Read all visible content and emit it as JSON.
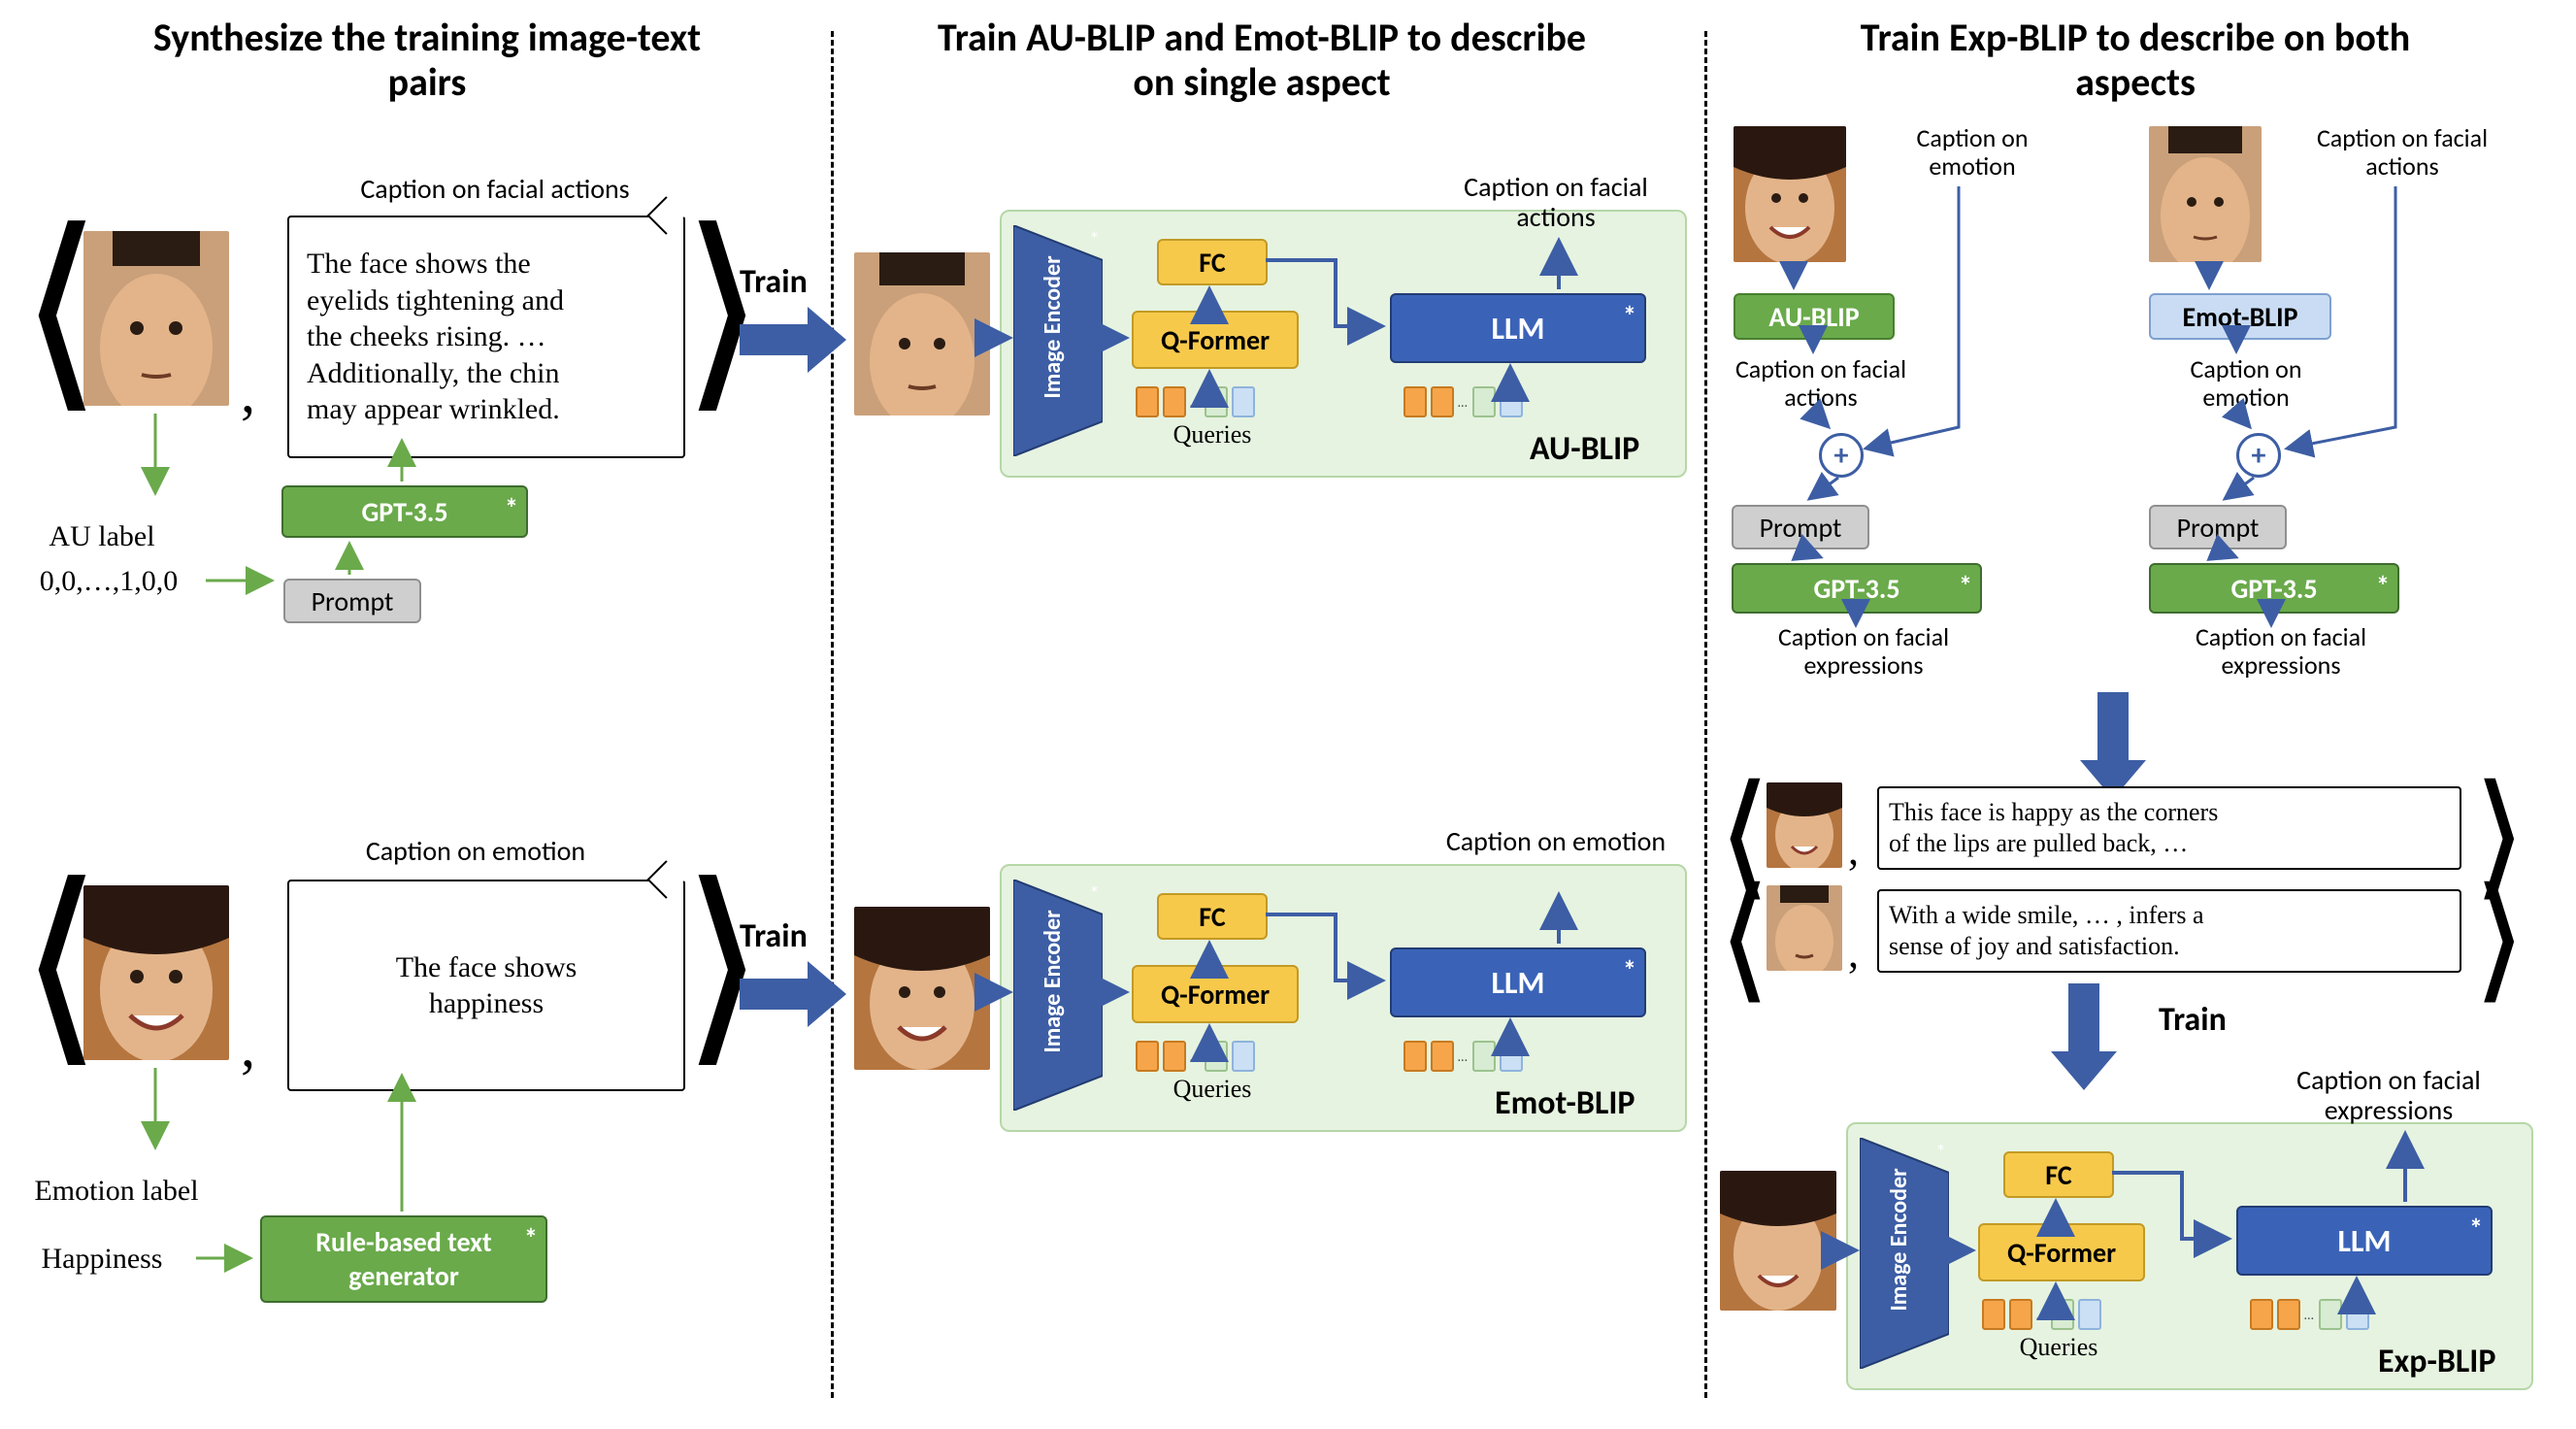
{
  "headings": {
    "col1": "Synthesize the training\nimage-text pairs",
    "col2": "Train AU-BLIP and Emot-BLIP to\ndescribe on single aspect",
    "col3": "Train Exp-BLIP to\ndescribe on both aspects"
  },
  "col1": {
    "au": {
      "caption_title": "Caption on facial actions",
      "caption_text": "The face shows the\neyelids tightening and\nthe cheeks rising. …\nAdditionally, the chin\nmay appear wrinkled.",
      "au_label_title": "AU label",
      "au_label_vector": "0,0,…,1,0,0",
      "gpt_block": "GPT-3.5",
      "prompt_block": "Prompt"
    },
    "emot": {
      "caption_title": "Caption on emotion",
      "caption_text": "The face shows\nhappiness",
      "emotion_label_title": "Emotion label",
      "emotion_label_value": "Happiness",
      "rule_block": "Rule-based text\ngenerator"
    },
    "train_label": "Train"
  },
  "col2": {
    "au": {
      "caption_out": "Caption on\nfacial actions",
      "blip_name": "AU-BLIP"
    },
    "emot": {
      "caption_out": "Caption on\nemotion",
      "blip_name": "Emot-BLIP"
    },
    "common": {
      "image_encoder": "Image\nEncoder",
      "fc": "FC",
      "qformer": "Q-Former",
      "llm": "LLM",
      "queries": "Queries"
    }
  },
  "col3": {
    "top_left": {
      "caption_in": "Caption on\nemotion",
      "blip_name": "AU-BLIP",
      "caption_mid": "Caption on\nfacial actions",
      "prompt": "Prompt",
      "gpt": "GPT-3.5",
      "caption_out": "Caption on\nfacial expressions"
    },
    "top_right": {
      "caption_in": "Caption on\nfacial actions",
      "blip_name": "Emot-BLIP",
      "caption_mid": "Caption on\nemotion",
      "prompt": "Prompt",
      "gpt": "GPT-3.5",
      "caption_out": "Caption on\nfacial expressions"
    },
    "pair1": "This face is happy as the corners\nof the lips are pulled back, …",
    "pair2": "With a wide smile, … , infers a\nsense of joy and satisfaction.",
    "train_label": "Train",
    "exp": {
      "caption_out": "Caption on\nfacial expressions",
      "blip_name": "Exp-BLIP",
      "fc": "FC",
      "qformer": "Q-Former",
      "llm": "LLM",
      "queries": "Queries",
      "image_encoder": "Image\nEncoder"
    }
  }
}
